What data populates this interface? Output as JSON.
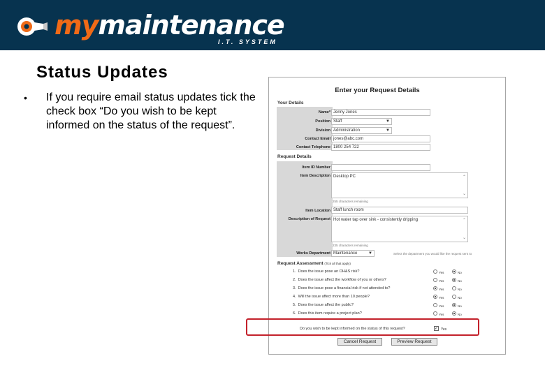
{
  "header": {
    "brand_my": "my",
    "brand_maintenance": "maintenance",
    "tagline": "I.T. SYSTEM",
    "logo_icon": "wrench-gear-logo-icon",
    "colors": {
      "banner": "#07334f",
      "accent": "#f06a17"
    }
  },
  "slide": {
    "title": "Status Updates",
    "bullet": "•",
    "text": "If you require email status updates tick the check box “Do you wish to be kept informed on the status of the request”."
  },
  "form": {
    "title": "Enter your Request Details",
    "your_details": {
      "heading": "Your Details",
      "name_label": "Name*",
      "name_value": "Jenny Jones",
      "position_label": "Position",
      "position_value": "Staff",
      "division_label": "Division",
      "division_value": "Administration",
      "email_label": "Contact Email",
      "email_value": "jones@abc.com",
      "phone_label": "Contact Telephone",
      "phone_value": "1800 254 722"
    },
    "request_details": {
      "heading": "Request Details",
      "item_id_label": "Item ID Number",
      "item_desc_label": "Item Description",
      "item_desc_value": "Desktop PC",
      "item_desc_hint": "255 characters remaining",
      "location_label": "Item Location",
      "location_value": "Staff lunch room",
      "request_desc_label": "Description of Request",
      "request_desc_value": "Hot water tap over sink - consistently dripping",
      "request_desc_hint": "235 characters remaining",
      "dept_label": "Works Department",
      "dept_value": "Maintenance",
      "dept_hint": "Select the department you would like the request sent to"
    },
    "assessment": {
      "heading": "Request Assessment",
      "heading_note": "(Tick all that apply)",
      "questions": [
        {
          "num": "1.",
          "text": "Does the issue pose an OH&S risk?",
          "answer": "No"
        },
        {
          "num": "2.",
          "text": "Does the issue affect the workflow of you or others?",
          "answer": "No"
        },
        {
          "num": "3.",
          "text": "Does the issue pose a financial risk if not attended to?",
          "answer": "Yes"
        },
        {
          "num": "4.",
          "text": "Will the issue affect more than 10 people?",
          "answer": "Yes"
        },
        {
          "num": "5.",
          "text": "Does the issue affect the public?",
          "answer": "No"
        },
        {
          "num": "6.",
          "text": "Does this item require a project plan?",
          "answer": "No"
        }
      ],
      "yes_label": "Yes",
      "no_label": "No"
    },
    "keep_informed": {
      "question": "Do you wish to be kept informed on the status of this request?",
      "checked": true,
      "yes_label": "Yes"
    },
    "buttons": {
      "cancel": "Cancel Request",
      "preview": "Preview Request"
    }
  }
}
